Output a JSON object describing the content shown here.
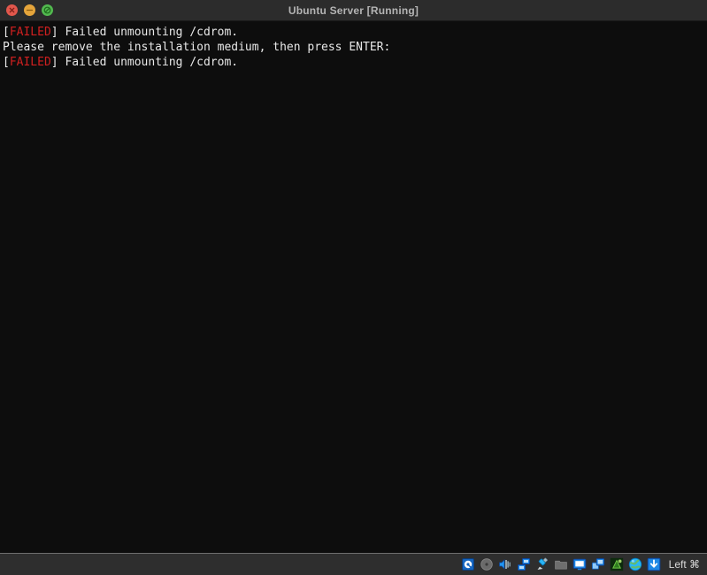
{
  "window": {
    "title": "Ubuntu Server [Running]",
    "controls": [
      {
        "name": "close",
        "glyph": "×",
        "color": "#e2574c"
      },
      {
        "name": "minimize",
        "glyph": "−",
        "color": "#e5a53b"
      },
      {
        "name": "maximize",
        "glyph": "⊘",
        "color": "#52b84f"
      }
    ]
  },
  "terminal": {
    "background": "#0d0d0d",
    "foreground": "#e8e8e8",
    "error_color": "#d02020",
    "lines": [
      {
        "segments": [
          {
            "text": "[",
            "color": "white"
          },
          {
            "text": "FAILED",
            "color": "red"
          },
          {
            "text": "] Failed unmounting /cdrom.",
            "color": "white"
          }
        ]
      },
      {
        "segments": [
          {
            "text": "Please remove the installation medium, then press ENTER:",
            "color": "white"
          }
        ]
      },
      {
        "segments": [
          {
            "text": "[",
            "color": "white"
          },
          {
            "text": "FAILED",
            "color": "red"
          },
          {
            "text": "] Failed unmounting /cdrom.",
            "color": "white"
          }
        ]
      }
    ],
    "plain_text": "[FAILED] Failed unmounting /cdrom.\nPlease remove the installation medium, then press ENTER:\n[FAILED] Failed unmounting /cdrom."
  },
  "statusbar": {
    "background": "#2e2e2e",
    "icons": [
      {
        "name": "hard-disk-icon",
        "label": "Hard Disks",
        "enabled": true
      },
      {
        "name": "optical-disk-icon",
        "label": "Optical Drives",
        "enabled": false
      },
      {
        "name": "audio-icon",
        "label": "Audio",
        "enabled": true
      },
      {
        "name": "network-icon",
        "label": "Network",
        "enabled": true
      },
      {
        "name": "usb-icon",
        "label": "USB Devices",
        "enabled": true
      },
      {
        "name": "shared-folders-icon",
        "label": "Shared Folders",
        "enabled": false
      },
      {
        "name": "display-icon",
        "label": "Display",
        "enabled": true
      },
      {
        "name": "recording-icon",
        "label": "Recording",
        "enabled": true
      },
      {
        "name": "features-icon",
        "label": "VT-x/AMD-V",
        "enabled": true
      },
      {
        "name": "mouse-integration-icon",
        "label": "Mouse Integration",
        "enabled": true
      },
      {
        "name": "host-key-icon",
        "label": "Host Key",
        "enabled": true
      }
    ],
    "host_key_label": "Left ⌘"
  }
}
